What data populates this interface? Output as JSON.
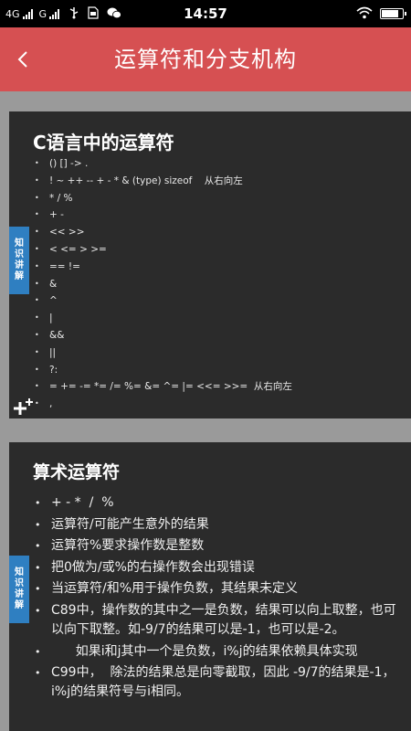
{
  "status_bar": {
    "network_1": "4G",
    "network_2": "G",
    "time": "14:57",
    "battery_level": 0.85,
    "icons": [
      "signal-icon",
      "signal-icon",
      "usb-icon",
      "sim-icon",
      "wechat-icon",
      "wifi-icon",
      "battery-icon"
    ]
  },
  "header": {
    "title": "运算符和分支机构",
    "back_icon": "chevron-left-icon",
    "background": "#d65052"
  },
  "slides": [
    {
      "title": "C语言中的运算符",
      "side_tab": "知识讲解",
      "bullets": [
        "() [] -> .",
        "! ~ ++ -- + - * & (type) sizeof    从右向左",
        "* / %",
        "+ -",
        "<< >>",
        "< <= > >=",
        "== !=",
        "&",
        "^",
        "|",
        "&&",
        "||",
        "?:",
        "= += -= *= /= %= &= ^= |= <<= >>=  从右向左",
        ","
      ]
    },
    {
      "title": "算术运算符",
      "side_tab": "知识讲解",
      "bullets": [
        "+ - *  /  %",
        "运算符/可能产生意外的结果",
        "运算符%要求操作数是整数",
        "把0做为/或%的右操作数会出现错误",
        "当运算符/和%用于操作负数，其结果未定义",
        "C89中，操作数的其中之一是负数，结果可以向上取整，也可以向下取整。如-9/7的结果可以是-1，也可以是-2。",
        "      如果i和j其中一个是负数，i%j的结果依赖具体实现",
        "C99中，  除法的结果总是向零截取，因此 -9/7的结果是-1，i%j的结果符号与i相同。"
      ]
    }
  ],
  "colors": {
    "slide_bg": "#2b2b2b",
    "tab_blue": "#2f7fc1",
    "page_bg": "#9a9a9a"
  }
}
